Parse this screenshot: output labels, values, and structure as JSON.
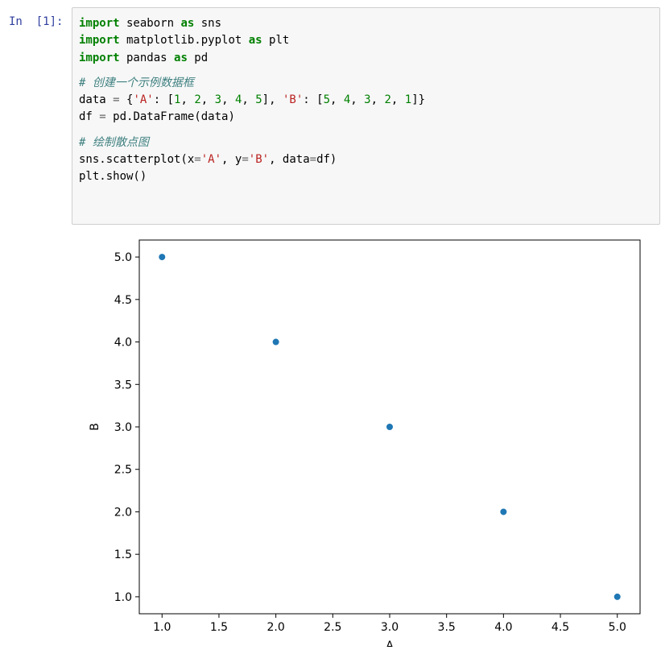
{
  "cell": {
    "prompt": "In  [1]:",
    "code_lines": [
      [
        {
          "t": "import",
          "c": "kw"
        },
        {
          "t": " seaborn ",
          "c": ""
        },
        {
          "t": "as",
          "c": "kw"
        },
        {
          "t": " sns",
          "c": ""
        }
      ],
      [
        {
          "t": "import",
          "c": "kw"
        },
        {
          "t": " matplotlib.pyplot ",
          "c": ""
        },
        {
          "t": "as",
          "c": "kw"
        },
        {
          "t": " plt",
          "c": ""
        }
      ],
      [
        {
          "t": "import",
          "c": "kw"
        },
        {
          "t": " pandas ",
          "c": ""
        },
        {
          "t": "as",
          "c": "kw"
        },
        {
          "t": " pd",
          "c": ""
        }
      ],
      [],
      [
        {
          "t": "# 创建一个示例数据框",
          "c": "cm"
        }
      ],
      [
        {
          "t": "data ",
          "c": ""
        },
        {
          "t": "=",
          "c": "op"
        },
        {
          "t": " {",
          "c": ""
        },
        {
          "t": "'A'",
          "c": "st"
        },
        {
          "t": ": [",
          "c": ""
        },
        {
          "t": "1",
          "c": "nm"
        },
        {
          "t": ", ",
          "c": ""
        },
        {
          "t": "2",
          "c": "nm"
        },
        {
          "t": ", ",
          "c": ""
        },
        {
          "t": "3",
          "c": "nm"
        },
        {
          "t": ", ",
          "c": ""
        },
        {
          "t": "4",
          "c": "nm"
        },
        {
          "t": ", ",
          "c": ""
        },
        {
          "t": "5",
          "c": "nm"
        },
        {
          "t": "], ",
          "c": ""
        },
        {
          "t": "'B'",
          "c": "st"
        },
        {
          "t": ": [",
          "c": ""
        },
        {
          "t": "5",
          "c": "nm"
        },
        {
          "t": ", ",
          "c": ""
        },
        {
          "t": "4",
          "c": "nm"
        },
        {
          "t": ", ",
          "c": ""
        },
        {
          "t": "3",
          "c": "nm"
        },
        {
          "t": ", ",
          "c": ""
        },
        {
          "t": "2",
          "c": "nm"
        },
        {
          "t": ", ",
          "c": ""
        },
        {
          "t": "1",
          "c": "nm"
        },
        {
          "t": "]}",
          "c": ""
        }
      ],
      [
        {
          "t": "df ",
          "c": ""
        },
        {
          "t": "=",
          "c": "op"
        },
        {
          "t": " pd.DataFrame(data)",
          "c": ""
        }
      ],
      [],
      [
        {
          "t": "# 绘制散点图",
          "c": "cm"
        }
      ],
      [
        {
          "t": "sns.scatterplot(x",
          "c": ""
        },
        {
          "t": "=",
          "c": "op"
        },
        {
          "t": "'A'",
          "c": "st"
        },
        {
          "t": ", y",
          "c": ""
        },
        {
          "t": "=",
          "c": "op"
        },
        {
          "t": "'B'",
          "c": "st"
        },
        {
          "t": ", data",
          "c": ""
        },
        {
          "t": "=",
          "c": "op"
        },
        {
          "t": "df)",
          "c": ""
        }
      ],
      [
        {
          "t": "plt.show()",
          "c": ""
        }
      ]
    ]
  },
  "chart_data": {
    "type": "scatter",
    "x": [
      1,
      2,
      3,
      4,
      5
    ],
    "y": [
      5,
      4,
      3,
      2,
      1
    ],
    "xlabel": "A",
    "ylabel": "B",
    "xlim": [
      0.8,
      5.2
    ],
    "ylim": [
      0.8,
      5.2
    ],
    "xticks": [
      "1.0",
      "1.5",
      "2.0",
      "2.5",
      "3.0",
      "3.5",
      "4.0",
      "4.5",
      "5.0"
    ],
    "yticks": [
      "1.0",
      "1.5",
      "2.0",
      "2.5",
      "3.0",
      "3.5",
      "4.0",
      "4.5",
      "5.0"
    ],
    "point_color": "#1f77b4",
    "grid": false
  }
}
